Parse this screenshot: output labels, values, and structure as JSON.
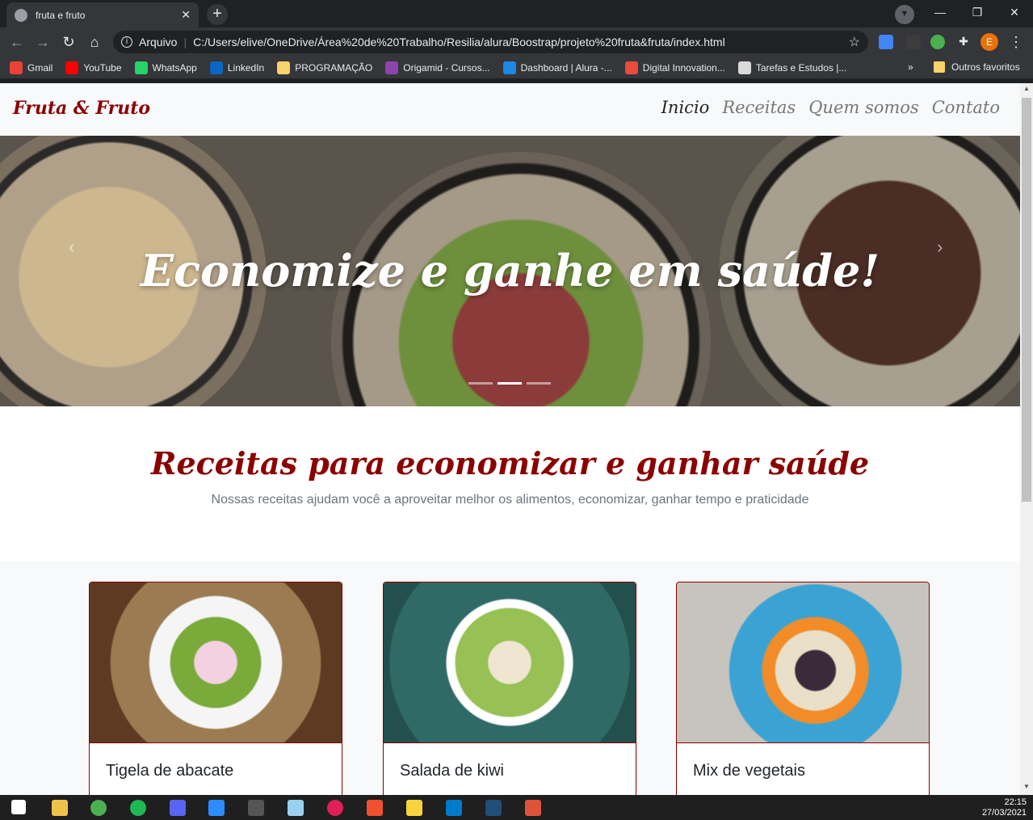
{
  "browser": {
    "tab_title": "fruta e fruto",
    "new_tab": "+",
    "address_security": "Arquivo",
    "url": "C:/Users/elive/OneDrive/Área%20de%20Trabalho/Resilia/alura/Boostrap/projeto%20fruta&fruta/index.html",
    "profile_initial": "E"
  },
  "bookmarks": [
    {
      "label": "Gmail",
      "color": "#ea4335"
    },
    {
      "label": "YouTube",
      "color": "#ff0000"
    },
    {
      "label": "WhatsApp",
      "color": "#25d366"
    },
    {
      "label": "LinkedIn",
      "color": "#0a66c2"
    },
    {
      "label": "PROGRAMAÇÃO",
      "color": "#f6d36b"
    },
    {
      "label": "Origamid - Cursos...",
      "color": "#8e44ad"
    },
    {
      "label": "Dashboard | Alura -...",
      "color": "#1e88e5"
    },
    {
      "label": "Digital Innovation...",
      "color": "#e74c3c"
    },
    {
      "label": "Tarefas e Estudos |...",
      "color": "#d9d9d9"
    }
  ],
  "bookmarks_more": "»",
  "bookmarks_other": "Outros favoritos",
  "site": {
    "brand": "Fruta & Fruto",
    "menu": [
      "Inicio",
      "Receitas",
      "Quem somos",
      "Contato"
    ],
    "hero_title": "Economize e ganhe em saúde!",
    "section_title": "Receitas para economizar e ganhar saúde",
    "section_subtitle": "Nossas receitas ajudam você a aproveitar melhor os alimentos, economizar, ganhar tempo e praticidade",
    "cards": [
      {
        "title": "Tigela de abacate"
      },
      {
        "title": "Salada de kiwi"
      },
      {
        "title": "Mix de vegetais"
      }
    ],
    "brand_color": "#8b0000"
  },
  "taskbar": {
    "time": "22:15",
    "date": "27/03/2021"
  }
}
